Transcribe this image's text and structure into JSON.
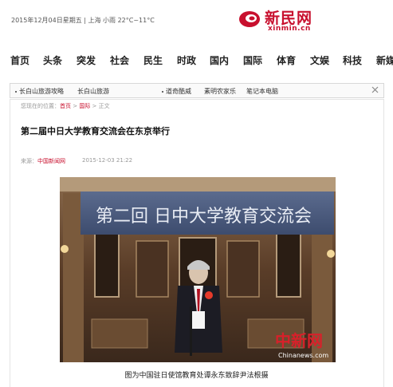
{
  "header": {
    "date_weather": "2015年12月04日星期五 | 上海 小雨 22°C~11°C",
    "logo_cn": "新民网",
    "logo_en": "xinmin.cn",
    "brand_color": "#c8102e"
  },
  "nav": {
    "items": [
      "首页",
      "头条",
      "突发",
      "社会",
      "民生",
      "时政",
      "国内",
      "国际",
      "体育",
      "文娱",
      "科技",
      "新媒"
    ]
  },
  "ads": {
    "items": [
      "长白山旅游攻略",
      "长白山旅游",
      "道奇酷威",
      "素明农家乐",
      "笔记本电脑"
    ]
  },
  "breadcrumb": {
    "prefix": "您现在的位置：",
    "home": "首页",
    "sep1": " > ",
    "section": "国际",
    "sep2": " > ",
    "current": "正文"
  },
  "article": {
    "title": "第二届中日大学教育交流会在东京举行",
    "source_label": "来源：",
    "source": "中国新闻网",
    "time": "2015-12-03 21:22",
    "banner_text": "第二回 日中大学教育交流会",
    "watermark_cn": "中新网",
    "watermark_en": "Chinanews.com",
    "caption": "图为中国驻日使馆教育处谭永东致辞尹法根摄"
  }
}
